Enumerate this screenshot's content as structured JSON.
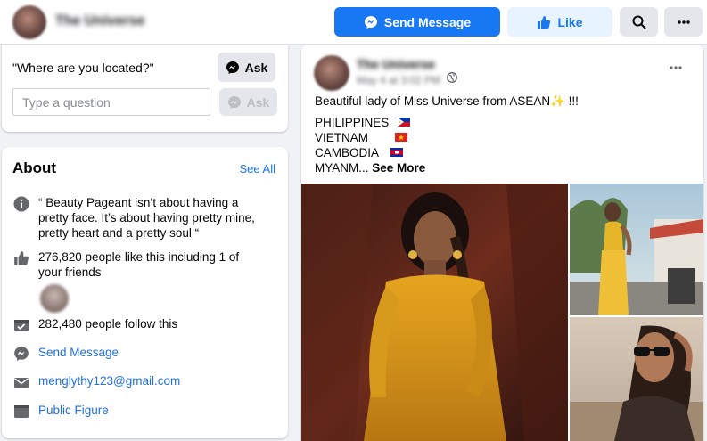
{
  "header": {
    "page_name": "The Universe",
    "send_message_label": "Send Message",
    "like_label": "Like"
  },
  "ask": {
    "question": "\"Where are you located?\"",
    "ask_label": "Ask",
    "input_placeholder": "Type a question",
    "ask_label_disabled": "Ask"
  },
  "about": {
    "title": "About",
    "see_all": "See All",
    "description": "“ Beauty Pageant isn’t about having a pretty face. It’s about having pretty mine, pretty heart and a pretty soul “",
    "likes": "276,820 people like this including 1 of your friends",
    "follows": "282,480 people follow this",
    "send_message": "Send Message",
    "email": "menglythy123@gmail.com",
    "category": "Public Figure"
  },
  "post": {
    "author": "The Universe",
    "date": "May 4 at 3:02 PM",
    "caption": "Beautiful lady of Miss Universe from ASEAN✨ !!!",
    "countries": [
      "PHILIPPINES",
      "VIETNAM",
      "CAMBODIA"
    ],
    "last_line": "MYANM...",
    "see_more": "See More"
  },
  "colors": {
    "brand_blue": "#1877f2",
    "light_blue": "#e7f3ff",
    "page_bg": "#f0f2f5",
    "gray_button": "#e4e6eb"
  },
  "icons": {
    "send": "messenger-icon",
    "like": "thumbs-up-icon",
    "search": "search-icon",
    "more": "more-dots-icon",
    "info": "info-icon",
    "follow": "follow-check-icon",
    "email": "envelope-icon",
    "category": "category-icon",
    "privacy": "globe-icon"
  }
}
